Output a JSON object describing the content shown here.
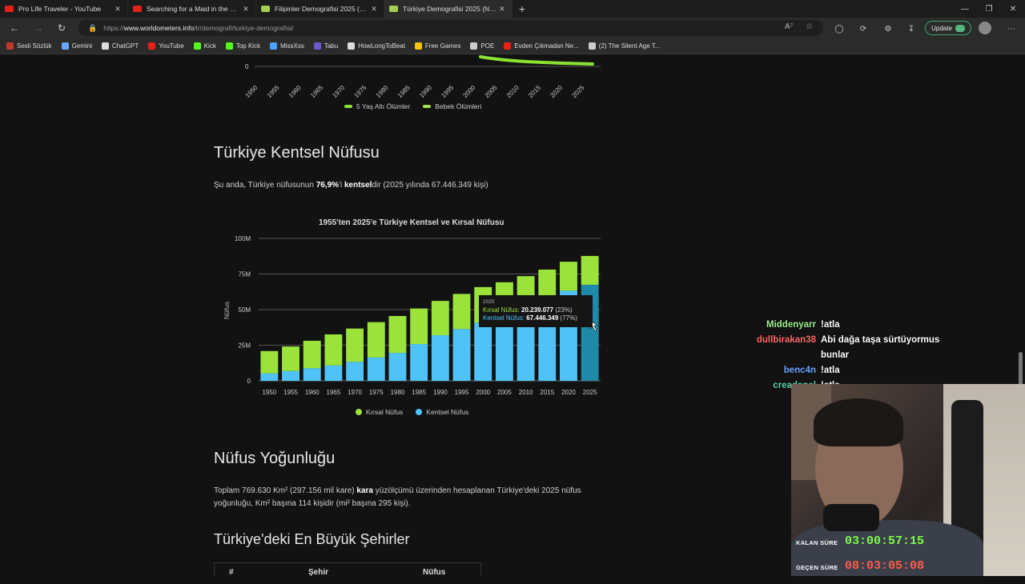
{
  "tabs": [
    {
      "title": "Pro Life Traveler - YouTube",
      "favicon": "youtube-icon",
      "color": "#e62117",
      "active": false
    },
    {
      "title": "Searching for a Maid in the Mani",
      "favicon": "ph-icon",
      "color": "#e62117",
      "active": false
    },
    {
      "title": "Filipinler Demografisi 2025 (Nüfus",
      "favicon": "worldometers-icon",
      "color": "#a5cf4c",
      "active": false
    },
    {
      "title": "Türkiye Demografisi 2025 (Nüfus",
      "favicon": "worldometers-icon",
      "color": "#a5cf4c",
      "active": true
    }
  ],
  "address": {
    "prefix": "https://",
    "host": "www.worldometers.info",
    "path": "/tr/demografi/turkiye-demografisi/"
  },
  "toolbar": {
    "update_label": "Update"
  },
  "bookmarks": [
    {
      "label": "Sesli Sözlük",
      "icon": "sesli-sozluk-icon",
      "color": "#c0392b"
    },
    {
      "label": "Gemini",
      "icon": "gemini-icon",
      "color": "#6aa8ff"
    },
    {
      "label": "ChatGPT",
      "icon": "chatgpt-icon",
      "color": "#dddddd"
    },
    {
      "label": "YouTube",
      "icon": "youtube-icon",
      "color": "#e62117"
    },
    {
      "label": "Kick",
      "icon": "kick-icon",
      "color": "#53fc18"
    },
    {
      "label": "Top Kick",
      "icon": "kick-icon",
      "color": "#53fc18"
    },
    {
      "label": "MissXss",
      "icon": "missxss-icon",
      "color": "#4aa3ff"
    },
    {
      "label": "Tabu",
      "icon": "tabu-icon",
      "color": "#6a5acd"
    },
    {
      "label": "HowLongToBeat",
      "icon": "hltb-icon",
      "color": "#dddddd"
    },
    {
      "label": "Free Games",
      "icon": "free-games-icon",
      "color": "#f1c40f"
    },
    {
      "label": "POE",
      "icon": "folder-icon",
      "color": "#cccccc"
    },
    {
      "label": "Evden Çıkmadan Ne...",
      "icon": "youtube-icon",
      "color": "#e62117"
    },
    {
      "label": "(2) The Silent Age T...",
      "icon": "globe-icon",
      "color": "#cccccc"
    }
  ],
  "top_chart": {
    "x_ticks": [
      "1950",
      "1955",
      "1960",
      "1965",
      "1970",
      "1975",
      "1980",
      "1985",
      "1990",
      "1995",
      "2000",
      "2005",
      "2010",
      "2015",
      "2020",
      "2025"
    ],
    "y_zero": "0",
    "legend": [
      "5 Yaş Altı Ölümler",
      "Bebek Ölümleri"
    ],
    "colors": [
      "#8be232",
      "#a6e04a"
    ]
  },
  "urban_section": {
    "heading": "Türkiye Kentsel Nüfusu",
    "text_before": "Şu anda, Türkiye nüfusunun ",
    "pct": "76,9%",
    "text_mid1": "'i ",
    "kentsel": "kentsel",
    "text_after": "dir (2025 yılında 67.446.349 kişi)"
  },
  "chart_data": {
    "type": "bar",
    "stacked": true,
    "title": "1955'ten 2025'e Türkiye Kentsel ve Kırsal Nüfusu",
    "ylabel": "Nüfus",
    "xlabel": "",
    "ylim": [
      0,
      100000000
    ],
    "y_ticks": [
      "0",
      "25M",
      "50M",
      "75M",
      "100M"
    ],
    "y_tick_values": [
      0,
      25000000,
      50000000,
      75000000,
      100000000
    ],
    "categories": [
      "1950",
      "1955",
      "1960",
      "1965",
      "1970",
      "1975",
      "1980",
      "1985",
      "1990",
      "1995",
      "2000",
      "2005",
      "2010",
      "2015",
      "2020",
      "2025"
    ],
    "series": [
      {
        "name": "Kentsel Nüfus",
        "color": "#4fc3f7",
        "values": [
          5200000,
          6900000,
          8800000,
          10800000,
          13300000,
          16400000,
          19600000,
          25800000,
          32000000,
          36300000,
          40900000,
          46200000,
          51500000,
          57500000,
          63300000,
          67446349
        ]
      },
      {
        "name": "Kırsal Nüfus",
        "color": "#9be33b",
        "values": [
          15700000,
          17200000,
          19300000,
          21800000,
          23400000,
          24800000,
          25900000,
          25000000,
          24100000,
          24700000,
          24900000,
          23000000,
          22000000,
          20600000,
          20300000,
          20239077
        ]
      }
    ],
    "legend": [
      "Kırsal Nüfus",
      "Kentsel Nüfus"
    ],
    "legend_position": "bottom-center",
    "highlight_index": 15,
    "highlight_color": "#1f8aa8",
    "grid": true
  },
  "tooltip": {
    "year": "2025",
    "rural_label": "Kırsal Nüfus:",
    "rural_value": "20.239.077",
    "rural_pct": "(23%)",
    "urban_label": "Kentsel Nüfus:",
    "urban_value": "67.446.349",
    "urban_pct": "(77%)"
  },
  "density_section": {
    "heading": "Nüfus Yoğunluğu",
    "text1": "Toplam 769.630 Km² (297.156 mil kare) ",
    "kara": "kara",
    "text2": " yüzölçümü üzerinden hesaplanan Türkiye'deki 2025 nüfus",
    "text3": "yoğunluğu, Km² başına 114 kişidir (mi² başına 295 kişi)."
  },
  "cities_section": {
    "heading": "Türkiye'deki En Büyük Şehirler",
    "columns": [
      "#",
      "Şehir",
      "Nüfus"
    ]
  },
  "chat": [
    {
      "user": "Middenyarr",
      "color": "#9ef08a",
      "text": "!atla"
    },
    {
      "user": "dullbirakan38",
      "color": "#ff6b6b",
      "text": "Abi dağa taşa sürtüyormus bunlar"
    },
    {
      "user": "benc4n",
      "color": "#6ea8ff",
      "text": "!atla"
    },
    {
      "user": "creadanel",
      "color": "#5fd3a8",
      "text": "!atla"
    }
  ],
  "timers": [
    {
      "label": "KALAN SÜRE",
      "value": "03:00:57:15",
      "color": "#7CFC4A"
    },
    {
      "label": "GEÇEN SÜRE",
      "value": "08:03:05:08",
      "color": "#ff5a4a"
    }
  ]
}
